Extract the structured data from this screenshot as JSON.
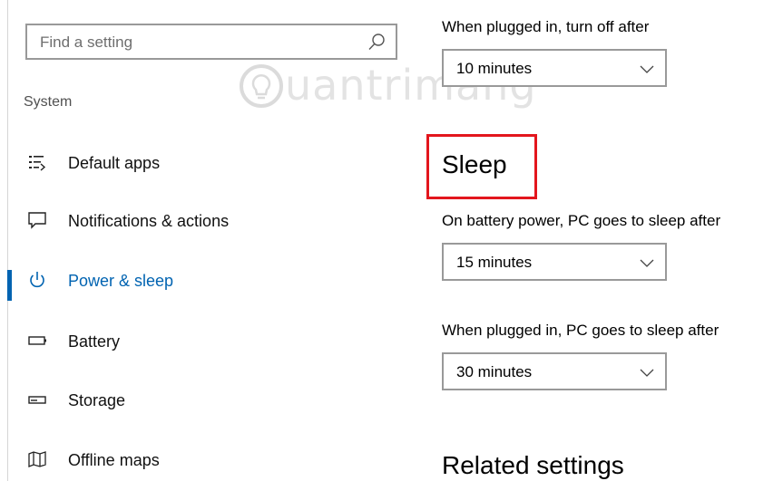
{
  "search": {
    "placeholder": "Find a setting",
    "icon": "search-icon"
  },
  "sidebar": {
    "section_label": "System",
    "items": [
      {
        "label": "Default apps",
        "icon": "default-apps-icon",
        "active": false
      },
      {
        "label": "Notifications & actions",
        "icon": "notifications-icon",
        "active": false
      },
      {
        "label": "Power & sleep",
        "icon": "power-icon",
        "active": true
      },
      {
        "label": "Battery",
        "icon": "battery-icon",
        "active": false
      },
      {
        "label": "Storage",
        "icon": "storage-icon",
        "active": false
      },
      {
        "label": "Offline maps",
        "icon": "map-icon",
        "active": false
      }
    ]
  },
  "watermark": {
    "text": "uantrimang",
    "icon": "lightbulb-icon"
  },
  "main": {
    "screen": {
      "plugged_label": "When plugged in, turn off after",
      "plugged_value": "10 minutes"
    },
    "sleep": {
      "heading": "Sleep",
      "battery_label": "On battery power, PC goes to sleep after",
      "battery_value": "15 minutes",
      "plugged_label": "When plugged in, PC goes to sleep after",
      "plugged_value": "30 minutes"
    },
    "related": {
      "heading": "Related settings"
    }
  },
  "colors": {
    "accent": "#0063b1",
    "highlight": "#e3161d",
    "border": "#999999"
  }
}
